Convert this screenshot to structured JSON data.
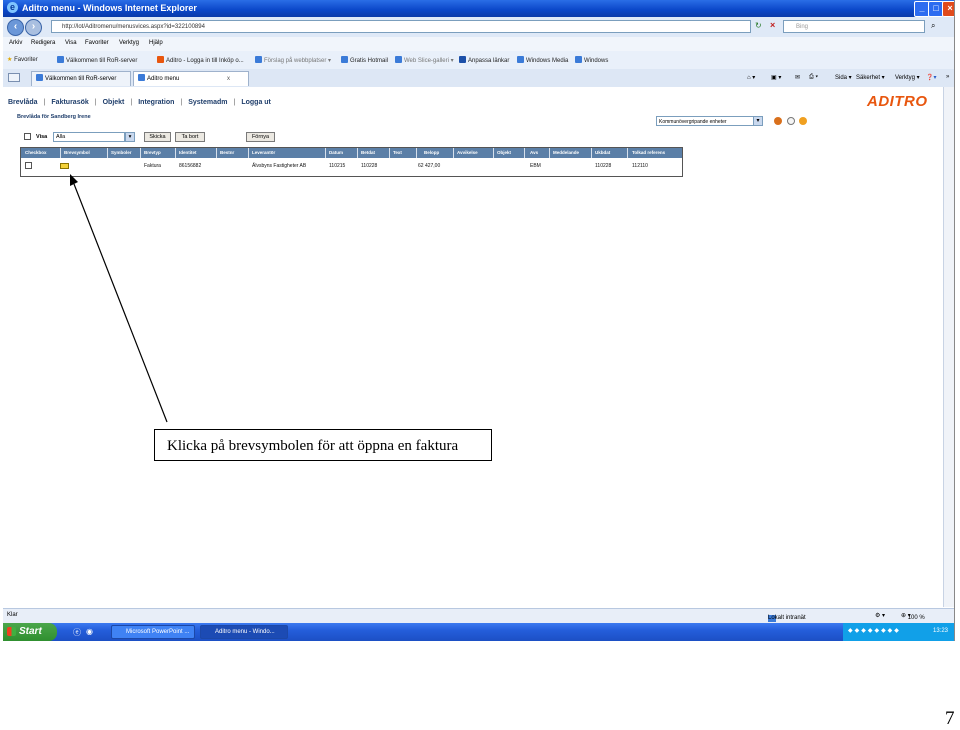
{
  "window": {
    "title": "Aditro menu - Windows Internet Explorer",
    "url": "http://lot/Aditromenu/menusvices.aspx?id=322100894",
    "search_placeholder": "Bing"
  },
  "menubar": [
    "Arkiv",
    "Redigera",
    "Visa",
    "Favoriter",
    "Verktyg",
    "Hjälp"
  ],
  "favorites_bar": [
    "Favoriter",
    "Välkommen till RoR-server",
    "Aditro - Logga in till Inköp o...",
    "Förslag på webbplatser",
    "Gratis Hotmail",
    "Web Slice-galleri",
    "Anpassa länkar",
    "Windows Media",
    "Windows"
  ],
  "tabs": [
    {
      "label": "Välkommen till RoR-server"
    },
    {
      "label": "Aditro menu"
    }
  ],
  "command_bar": {
    "page": "Sida",
    "safety": "Säkerhet",
    "tools": "Verktyg"
  },
  "app": {
    "nav": [
      "Brevlåda",
      "Fakturasök",
      "Objekt",
      "Integration",
      "Systemadm",
      "Logga ut"
    ],
    "subtitle": "Brevlåda för Sandberg Irene",
    "logo": "ADITRO",
    "department_select": "Kommunövergripande enheter",
    "toolbar": {
      "visa_label": "Visa",
      "filter_value": "Alla",
      "send_button": "Skicka",
      "delete_button": "Ta bort",
      "refresh_button": "Förnya"
    },
    "table": {
      "columns": [
        "Checkbox",
        "Brevsymbol",
        "Symboler",
        "Brevtyp",
        "Identitet",
        "Bestnr",
        "Leverantör",
        "Datum",
        "Betdat",
        "Text",
        "Belopp",
        "Avvikelse",
        "Objekt",
        "Avs",
        "Meddelande",
        "Ukbdat",
        "Tolkad referens"
      ],
      "rows": [
        {
          "brevtyp": "Faktura",
          "identitet": "86156882",
          "leverantor": "Älvsbyns Fastigheter AB",
          "datum": "110215",
          "betdat": "110228",
          "belopp": "62 427,00",
          "avs": "EBM",
          "ukbdat": "110228",
          "tolkad_referens": "112110"
        }
      ]
    }
  },
  "statusbar": {
    "left": "Klar",
    "zone": "Lokalt intranät",
    "zoom": "100 %"
  },
  "taskbar": {
    "start": "Start",
    "buttons": [
      "Microsoft PowerPoint ...",
      "Aditro menu - Windo..."
    ],
    "clock": "13:23"
  },
  "callout": "Klicka på brevsymbolen för att öppna en faktura",
  "page_number": "7"
}
